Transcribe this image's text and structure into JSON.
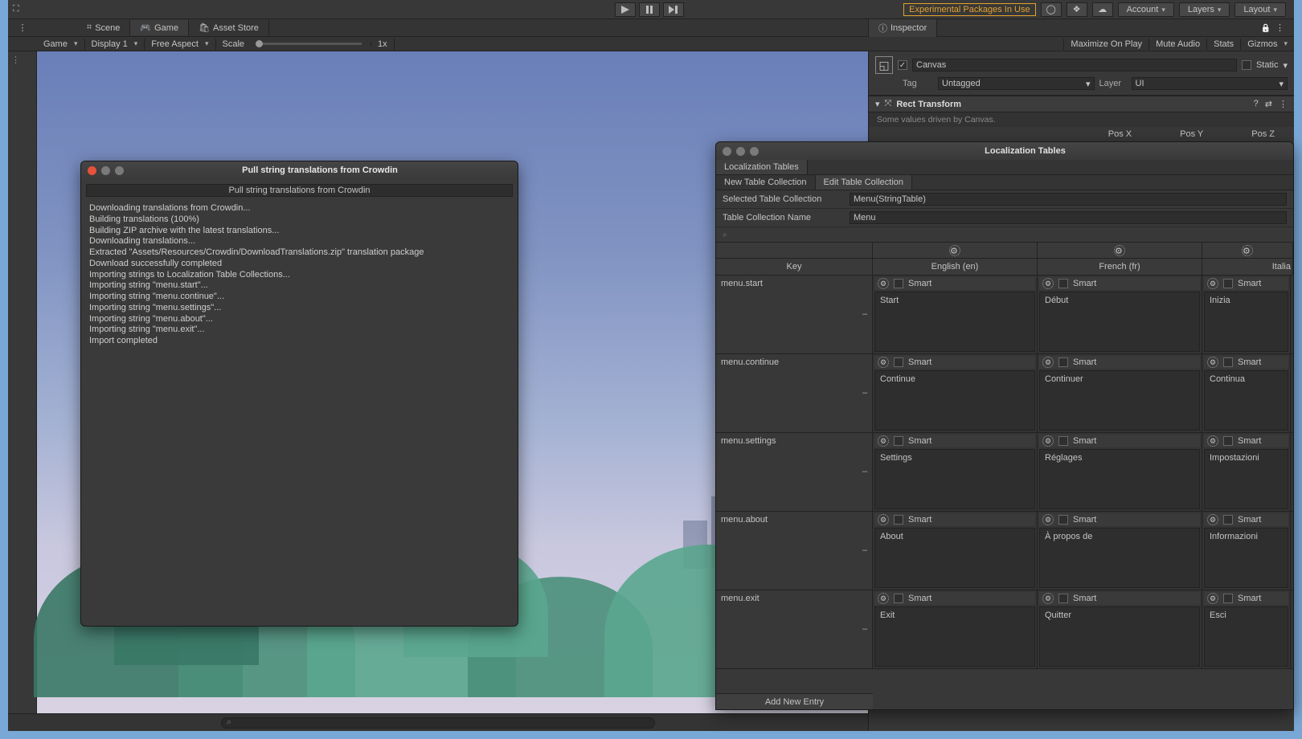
{
  "top": {
    "warn": "Experimental Packages In Use",
    "account": "Account",
    "layers": "Layers",
    "layout": "Layout"
  },
  "tabs": {
    "scene": "Scene",
    "game": "Game",
    "asset_store": "Asset Store",
    "inspector": "Inspector"
  },
  "game_toolbar": {
    "game": "Game",
    "display": "Display 1",
    "aspect": "Free Aspect",
    "scale": "Scale",
    "scale_val": "1x",
    "maximize": "Maximize On Play",
    "mute": "Mute Audio",
    "stats": "Stats",
    "gizmos": "Gizmos"
  },
  "inspector": {
    "name": "Canvas",
    "static": "Static",
    "tag_lbl": "Tag",
    "tag_val": "Untagged",
    "layer_lbl": "Layer",
    "layer_val": "UI",
    "rect": "Rect Transform",
    "driven": "Some values driven by Canvas.",
    "pos_x": "Pos X",
    "pos_y": "Pos Y",
    "pos_z": "Pos Z"
  },
  "dialog": {
    "title": "Pull string translations from Crowdin",
    "progress_label": "Pull string translations from Crowdin",
    "log": [
      "Downloading translations from Crowdin...",
      "Building translations (100%)",
      "Building ZIP archive with the latest translations...",
      "Downloading translations...",
      "Extracted \"Assets/Resources/Crowdin/DownloadTranslations.zip\" translation package",
      "Download successfully completed",
      "Importing strings to Localization Table Collections...",
      "Importing string \"menu.start\"...",
      "Importing string \"menu.continue\"...",
      "Importing string \"menu.settings\"...",
      "Importing string \"menu.about\"...",
      "Importing string \"menu.exit\"...",
      "Import completed"
    ]
  },
  "loc": {
    "title": "Localization Tables",
    "tab": "Localization Tables",
    "sub_new": "New Table Collection",
    "sub_edit": "Edit Table Collection",
    "sel_lbl": "Selected Table Collection",
    "sel_val": "Menu(StringTable)",
    "name_lbl": "Table Collection Name",
    "name_val": "Menu",
    "cols": {
      "key": "Key",
      "en": "English (en)",
      "fr": "French (fr)",
      "it": "Italia"
    },
    "smart": "Smart",
    "add": "Add New Entry",
    "rows": [
      {
        "key": "menu.start",
        "en": "Start",
        "fr": "Début",
        "it": "Inizia"
      },
      {
        "key": "menu.continue",
        "en": "Continue",
        "fr": "Continuer",
        "it": "Continua"
      },
      {
        "key": "menu.settings",
        "en": "Settings",
        "fr": "Réglages",
        "it": "Impostazioni"
      },
      {
        "key": "menu.about",
        "en": "About",
        "fr": "À propos de",
        "it": "Informazioni"
      },
      {
        "key": "menu.exit",
        "en": "Exit",
        "fr": "Quitter",
        "it": "Esci"
      }
    ]
  }
}
